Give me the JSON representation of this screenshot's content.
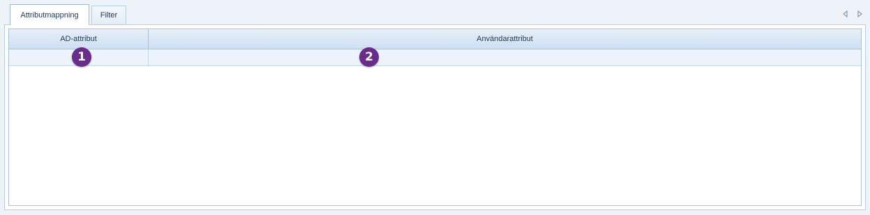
{
  "tabs": [
    {
      "label": "Attributmappning",
      "active": true
    },
    {
      "label": "Filter",
      "active": false
    }
  ],
  "tab_nav": {
    "prev_icon": "triangle-left-icon",
    "next_icon": "triangle-right-icon"
  },
  "grid": {
    "columns": [
      {
        "header": "AD-attribut"
      },
      {
        "header": "Användarattribut"
      }
    ],
    "filter_row": [
      "",
      ""
    ],
    "rows": []
  },
  "annotations": [
    {
      "label": "1"
    },
    {
      "label": "2"
    }
  ],
  "colors": {
    "background": "#eef3fa",
    "header_gradient_top": "#e7eff9",
    "header_gradient_bottom": "#cfdff2",
    "border": "#a9c1d9",
    "text": "#1e395b",
    "badge": "#6a2c8a"
  }
}
